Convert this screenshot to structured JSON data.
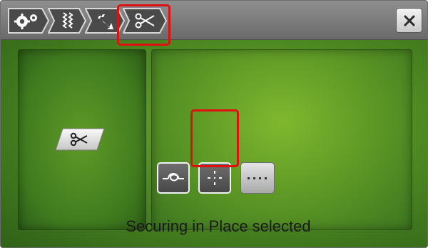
{
  "topbar": {
    "breadcrumbs": [
      {
        "icon": "settings-gears-icon"
      },
      {
        "icon": "stitch-zigzag-icon"
      },
      {
        "icon": "sewing-arrow-icon"
      },
      {
        "icon": "scissors-icon",
        "active": true
      }
    ],
    "close_icon": "close-icon"
  },
  "left_panel": {
    "button_icon": "scissors-icon"
  },
  "right_panel": {
    "options": [
      {
        "icon": "knot-icon",
        "selected": false
      },
      {
        "icon": "securing-in-place-icon",
        "selected": true
      },
      {
        "icon": "dotted-line-icon",
        "selected": false
      }
    ],
    "status_text": "Securing in Place selected"
  },
  "colors": {
    "accent_highlight": "#e01010",
    "background_green": "#5a9525"
  }
}
